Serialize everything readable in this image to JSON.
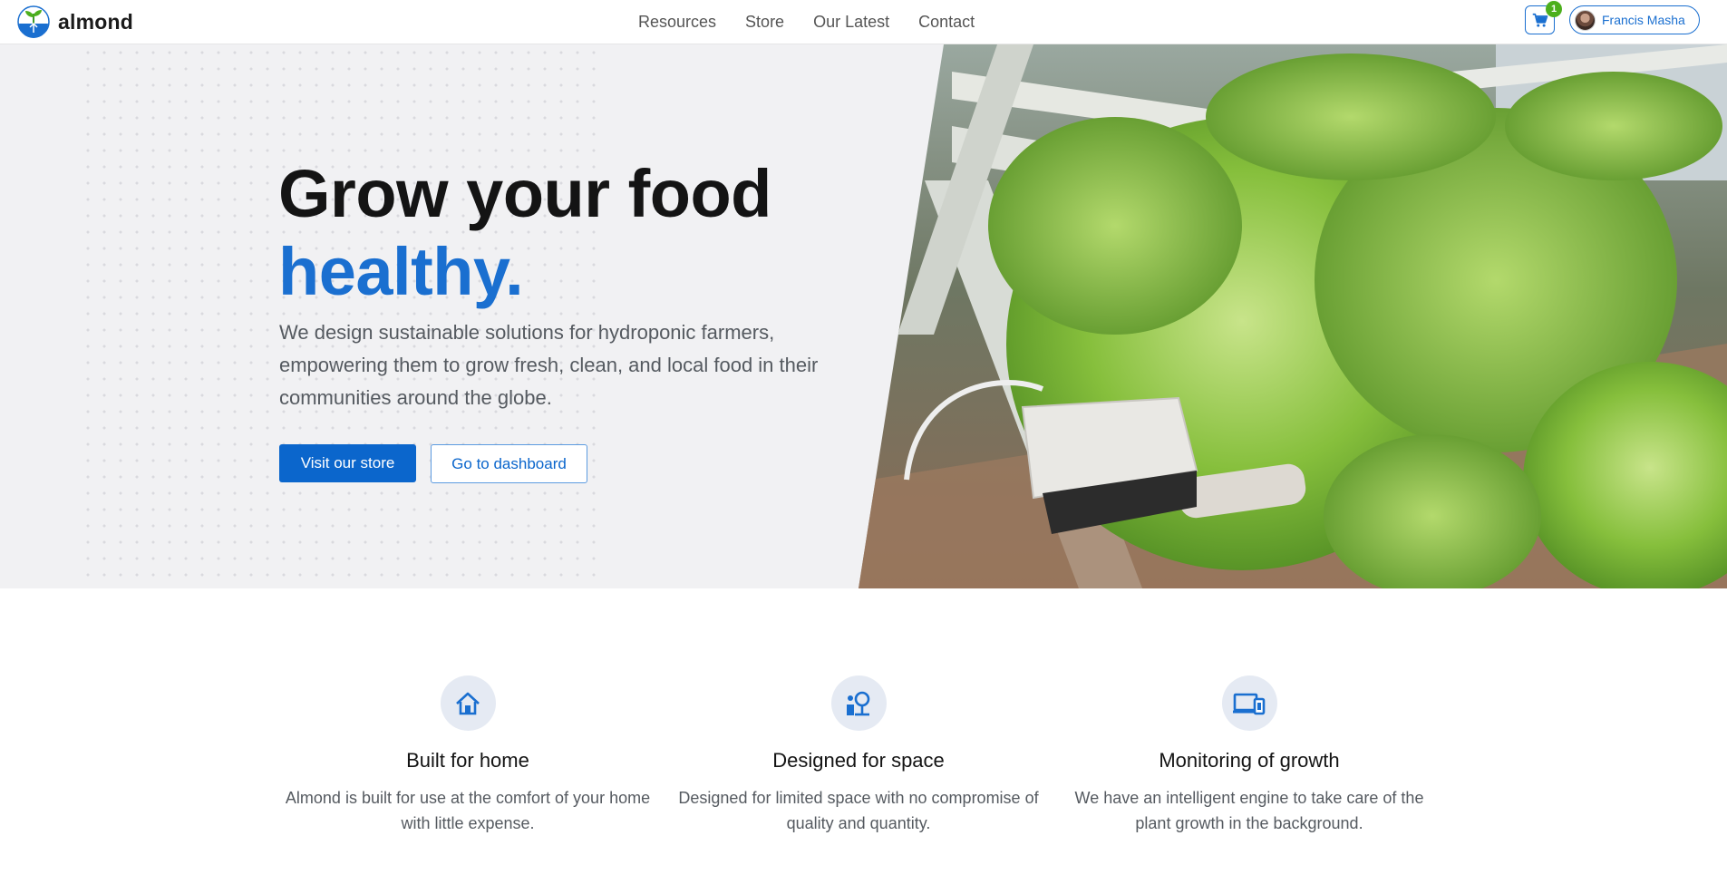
{
  "brand": {
    "name": "almond",
    "logo_icon": "almond-sprout-logo"
  },
  "nav": {
    "links": [
      {
        "label": "Resources"
      },
      {
        "label": "Store"
      },
      {
        "label": "Our Latest"
      },
      {
        "label": "Contact"
      }
    ]
  },
  "cart": {
    "icon": "cart-icon",
    "count": "1"
  },
  "user": {
    "name": "Francis Masha",
    "avatar_icon": "avatar"
  },
  "hero": {
    "title_line1": "Grow your food",
    "title_line2": "healthy.",
    "description": "We design sustainable solutions for hydroponic farmers, empowering them to grow fresh, clean, and local food in their communities around the globe.",
    "primary_button": "Visit our store",
    "secondary_button": "Go to dashboard",
    "image": "hydroponic-lettuce-photo"
  },
  "features": [
    {
      "icon": "home-icon",
      "title": "Built for home",
      "text": "Almond is built for use at the comfort of your home with little expense."
    },
    {
      "icon": "space-icon",
      "title": "Designed for space",
      "text": "Designed for limited space with no compromise of quality and quantity."
    },
    {
      "icon": "devices-icon",
      "title": "Monitoring of growth",
      "text": "We have an intelligent engine to take care of the plant growth in the background."
    }
  ],
  "colors": {
    "accent": "#1a6fd0",
    "primary_button": "#0b66cc",
    "badge": "#4caf1c",
    "hero_bg": "#f1f1f3"
  }
}
